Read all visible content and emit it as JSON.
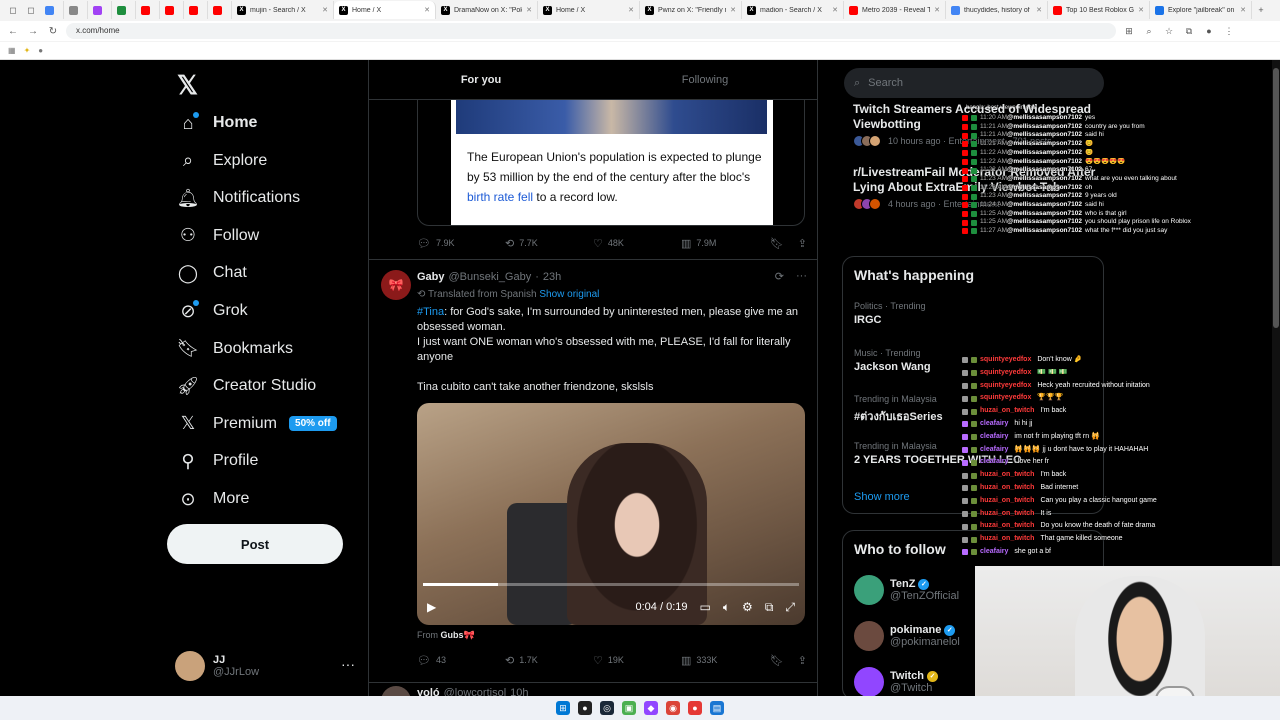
{
  "browser": {
    "tabs": [
      {
        "label": "",
        "color": "#4285f4",
        "icon": "grid-icon"
      },
      {
        "label": "",
        "color": "#888888",
        "icon": "settings-icon"
      },
      {
        "label": "",
        "color": "#a142f4",
        "icon": "app-icon"
      },
      {
        "label": "",
        "color": "#1e8e3e",
        "icon": "sheets-icon"
      },
      {
        "label": "",
        "color": "#ff0000",
        "icon": "youtube-icon"
      },
      {
        "label": "",
        "color": "#ff0000",
        "icon": "youtube-icon"
      },
      {
        "label": "",
        "color": "#ff0000",
        "icon": "youtube-icon"
      },
      {
        "label": "",
        "color": "#ff0000",
        "icon": "youtube-icon"
      },
      {
        "label": "mujin - Search / X",
        "color": "#000000",
        "icon": "x-icon"
      },
      {
        "label": "Home / X",
        "color": "#000000",
        "icon": "x-icon",
        "active": true
      },
      {
        "label": "DramaNow on X: \"Poki...",
        "color": "#000000",
        "icon": "x-icon"
      },
      {
        "label": "Home / X",
        "color": "#000000",
        "icon": "x-icon"
      },
      {
        "label": "Pwnz on X: \"Friendly rem...",
        "color": "#000000",
        "icon": "x-icon"
      },
      {
        "label": "madion - Search / X",
        "color": "#000000",
        "icon": "x-icon"
      },
      {
        "label": "Metro 2039 - Reveal Tr...",
        "color": "#ff0000",
        "icon": "youtube-icon"
      },
      {
        "label": "thucydides, history of ...",
        "color": "#4285f4",
        "icon": "google-icon"
      },
      {
        "label": "Top 10 Best Roblox Gam...",
        "color": "#ff0000",
        "icon": "youtube-icon"
      },
      {
        "label": "Explore \"jailbreak\" on R...",
        "color": "#1a73e8",
        "icon": "roblox-icon"
      }
    ],
    "url": "x.com/home"
  },
  "nav": {
    "items": [
      {
        "label": "Home",
        "icon": "home-icon"
      },
      {
        "label": "Explore",
        "icon": "search-icon"
      },
      {
        "label": "Notifications",
        "icon": "bell-icon"
      },
      {
        "label": "Follow",
        "icon": "person-add-icon"
      },
      {
        "label": "Chat",
        "icon": "chat-icon"
      },
      {
        "label": "Grok",
        "icon": "grok-icon"
      },
      {
        "label": "Bookmarks",
        "icon": "bookmark-icon"
      },
      {
        "label": "Creator Studio",
        "icon": "rocket-icon"
      },
      {
        "label": "Premium",
        "icon": "x-icon"
      },
      {
        "label": "Profile",
        "icon": "person-icon"
      },
      {
        "label": "More",
        "icon": "more-circle-icon"
      }
    ],
    "premium_badge": "50% off",
    "post_label": "Post",
    "account": {
      "name": "JJ",
      "handle": "@JJrLow",
      "more": "···"
    }
  },
  "feed": {
    "tabs": [
      "For you",
      "Following"
    ],
    "card1": {
      "text_before": "The European Union's population is expected to plunge by 53 million by the end of the century after the bloc's ",
      "link": "birth rate fell",
      "text_after": " to a record low."
    },
    "tweet1_actions": {
      "replies": "7.9K",
      "reposts": "7.7K",
      "likes": "48K",
      "views": "7.9M"
    },
    "tweet2": {
      "name": "Gaby",
      "handle": "@Bunseki_Gaby",
      "time": "23h",
      "translated": "Translated from Spanish",
      "show_original": "Show original",
      "hashtag": "#Tina",
      "line1": ": for God's sake, I'm surrounded by uninterested men, please give me an obsessed woman.",
      "line2": "I just want ONE woman who's obsessed with me, PLEASE, I'd fall for literally anyone",
      "line3": "Tina cubito can't take another friendzone, skslsls",
      "video_time": "0:04 / 0:19",
      "video_progress": 0.2,
      "from_label": "From",
      "from_name": "Gubs🎀",
      "actions": {
        "replies": "43",
        "reposts": "1.7K",
        "likes": "19K",
        "views": "333K"
      }
    },
    "tweet3": {
      "name": "yoló",
      "handle": "@lowcortisol",
      "time": "10h"
    }
  },
  "right": {
    "search_placeholder": "Search",
    "news": [
      {
        "title": "Twitch Streamers Accused of Widespread Viewbotting",
        "meta": "10 hours ago · Entertainment · 701 posts"
      },
      {
        "title": "r/LivestreamFail Moderator Removed After Lying About ExtraEmily Viewbot Tab",
        "meta": "4 hours ago · Entertainment"
      }
    ],
    "happening_title": "What's happening",
    "trends": [
      {
        "cat": "Politics · Trending",
        "name": "IRGC"
      },
      {
        "cat": "Music · Trending",
        "name": "Jackson Wang"
      },
      {
        "cat": "Trending in Malaysia",
        "name": "#ต่วงกับเธอSeries"
      },
      {
        "cat": "Trending in Malaysia",
        "name": "2 YEARS TOGETHER WITH LEO"
      }
    ],
    "show_more": "Show more",
    "follow_title": "Who to follow",
    "follow": [
      {
        "name": "TenZ",
        "handle": "@TenZOfficial",
        "color": "#3aa07a"
      },
      {
        "name": "pokimane",
        "handle": "@pokimanelol",
        "color": "#6b4a3f"
      },
      {
        "name": "Twitch",
        "handle": "@Twitch",
        "color": "#9146ff"
      }
    ]
  },
  "chat_top": {
    "header": "bengla: best viewer in chat",
    "messages": [
      {
        "time": "11:20 AM",
        "user": "@mellissasampson7102",
        "text": "yes"
      },
      {
        "time": "11:21 AM",
        "user": "@mellissasampson7102",
        "text": "country are you from"
      },
      {
        "time": "11:21 AM",
        "user": "@mellissasampson7102",
        "text": "said hi"
      },
      {
        "time": "11:21 AM",
        "user": "@mellissasampson7102",
        "text": "😊"
      },
      {
        "time": "11:22 AM",
        "user": "@mellissasampson7102",
        "text": "😊"
      },
      {
        "time": "11:22 AM",
        "user": "@mellissasampson7102",
        "text": "😍😍😍😍😍"
      },
      {
        "time": "11:22 AM",
        "user": "@mellissasampson7102",
        "text": "67"
      },
      {
        "time": "11:23 AM",
        "user": "@mellissasampson7102",
        "text": "what are you even talking about"
      },
      {
        "time": "11:23 AM",
        "user": "@mellissasampson7102",
        "text": "oh"
      },
      {
        "time": "11:23 AM",
        "user": "@mellissasampson7102",
        "text": "9 years old"
      },
      {
        "time": "11:24 AM",
        "user": "@mellissasampson7102",
        "text": "said hi"
      },
      {
        "time": "11:25 AM",
        "user": "@mellissasampson7102",
        "text": "who is that girl"
      },
      {
        "time": "11:25 AM",
        "user": "@mellissasampson7102",
        "text": "you should play prison life on Roblox"
      },
      {
        "time": "11:27 AM",
        "user": "@mellissasampson7102",
        "text": "what the f*** did you just say"
      }
    ]
  },
  "chat_bottom": {
    "messages": [
      {
        "user": "squintyeyedfox",
        "text": "Don't know 🤌",
        "cls": ""
      },
      {
        "user": "squintyeyedfox",
        "text": "💵 💵 💵",
        "cls": ""
      },
      {
        "user": "squintyeyedfox",
        "text": "Heck yeah recruited without initation",
        "cls": ""
      },
      {
        "user": "squintyeyedfox",
        "text": "🏆🏆🏆",
        "cls": ""
      },
      {
        "user": "huzai_on_twitch",
        "text": "I'm back",
        "cls": ""
      },
      {
        "user": "cleafairy",
        "text": "hi hi jj",
        "cls": "purple"
      },
      {
        "user": "cleafairy",
        "text": "im not fr im playing tft rn 🙀",
        "cls": "purple"
      },
      {
        "user": "cleafairy",
        "text": "🙀🙀🙀 jj u dont have to play it HAHAHAH",
        "cls": "purple"
      },
      {
        "user": "cleafairy",
        "text": "i love her fr",
        "cls": "purple"
      },
      {
        "user": "huzai_on_twitch",
        "text": "I'm back",
        "cls": ""
      },
      {
        "user": "huzai_on_twitch",
        "text": "Bad internet",
        "cls": ""
      },
      {
        "user": "huzai_on_twitch",
        "text": "Can you play a classic hangout game",
        "cls": ""
      },
      {
        "user": "huzai_on_twitch",
        "text": "It is",
        "cls": ""
      },
      {
        "user": "huzai_on_twitch",
        "text": "Do you know the death of fate drama",
        "cls": ""
      },
      {
        "user": "huzai_on_twitch",
        "text": "That game killed someone",
        "cls": ""
      },
      {
        "user": "cleafairy",
        "text": "she got a bf",
        "cls": "purple"
      }
    ]
  }
}
